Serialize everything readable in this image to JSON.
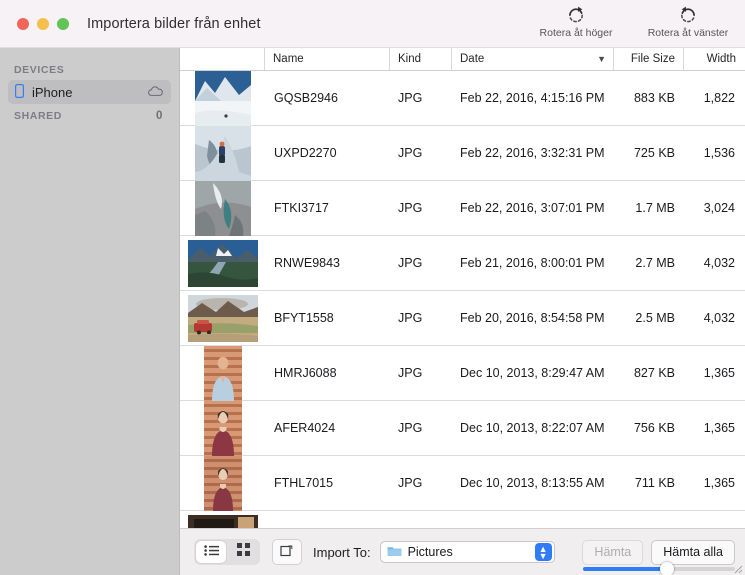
{
  "window": {
    "title": "Importera bilder från enhet",
    "traffic_lights": [
      "close",
      "minimize",
      "zoom"
    ]
  },
  "toolbar": {
    "buttons": [
      {
        "label": "Rotera åt höger",
        "icon": "rotate-right-icon"
      },
      {
        "label": "Rotera åt vänster",
        "icon": "rotate-left-icon"
      }
    ]
  },
  "sidebar": {
    "sections": [
      {
        "header": "DEVICES",
        "count": "",
        "items": [
          {
            "label": "iPhone",
            "icon": "iphone-icon",
            "accessory": "cloud-icon",
            "selected": true
          }
        ]
      },
      {
        "header": "SHARED",
        "count": "0",
        "items": []
      }
    ]
  },
  "table": {
    "columns": [
      {
        "key": "thumb",
        "label": ""
      },
      {
        "key": "name",
        "label": "Name"
      },
      {
        "key": "kind",
        "label": "Kind"
      },
      {
        "key": "date",
        "label": "Date",
        "sorted": true
      },
      {
        "key": "size",
        "label": "File Size"
      },
      {
        "key": "width",
        "label": "Width"
      }
    ],
    "rows": [
      {
        "name": "GQSB2946",
        "kind": "JPG",
        "date": "Feb 22, 2016, 4:15:16 PM",
        "size": "883 KB",
        "width": "1,822",
        "thumb": "snow-peak"
      },
      {
        "name": "UXPD2270",
        "kind": "JPG",
        "date": "Feb 22, 2016, 3:32:31 PM",
        "size": "725 KB",
        "width": "1,536",
        "thumb": "ice-climber"
      },
      {
        "name": "FTKI3717",
        "kind": "JPG",
        "date": "Feb 22, 2016, 3:07:01 PM",
        "size": "1.7 MB",
        "width": "3,024",
        "thumb": "glacier-crevasse"
      },
      {
        "name": "RNWE9843",
        "kind": "JPG",
        "date": "Feb 21, 2016, 8:00:01 PM",
        "size": "2.7 MB",
        "width": "4,032",
        "thumb": "mountain-river"
      },
      {
        "name": "BFYT1558",
        "kind": "JPG",
        "date": "Feb 20, 2016, 8:54:58 PM",
        "size": "2.5 MB",
        "width": "4,032",
        "thumb": "red-van-desert"
      },
      {
        "name": "HMRJ6088",
        "kind": "JPG",
        "date": "Dec 10, 2013, 8:29:47 AM",
        "size": "827 KB",
        "width": "1,365",
        "thumb": "portrait-blue-shirt"
      },
      {
        "name": "AFER4024",
        "kind": "JPG",
        "date": "Dec 10, 2013, 8:22:07 AM",
        "size": "756 KB",
        "width": "1,365",
        "thumb": "portrait-maroon-a"
      },
      {
        "name": "FTHL7015",
        "kind": "JPG",
        "date": "Dec 10, 2013, 8:13:55 AM",
        "size": "711 KB",
        "width": "1,365",
        "thumb": "portrait-maroon-b"
      },
      {
        "name": "",
        "kind": "",
        "date": "",
        "size": "",
        "width": "",
        "thumb": "interior-room"
      }
    ]
  },
  "bottombar": {
    "view_list_icon": "list-view-icon",
    "view_grid_icon": "grid-view-icon",
    "rotate_icon": "rotate-square-icon",
    "import_to_label": "Import To:",
    "destination": "Pictures",
    "destination_icon": "folder-icon",
    "import_selected_label": "Hämta",
    "import_selected_disabled": true,
    "import_all_label": "Hämta alla",
    "zoom_slider_value": "55"
  },
  "colors": {
    "accent": "#2f7cf6",
    "titlebar": "#f7f2f5",
    "sidebar": "#cccccd",
    "bottombar": "#f1eef0"
  }
}
